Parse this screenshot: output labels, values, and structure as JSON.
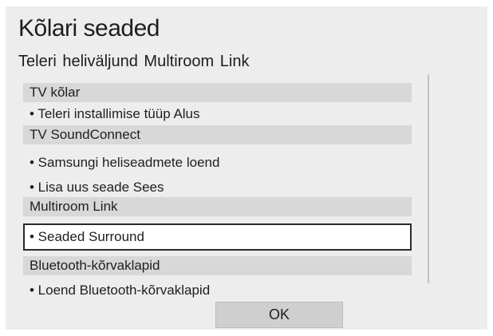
{
  "dialog": {
    "title": "Kõlari seaded",
    "subtitle": "Teleri heliväljund  Multiroom Link"
  },
  "list": {
    "tv_speaker_header": "TV kõlar",
    "tv_install_type": "• Teleri installimise tüüp Alus",
    "soundconnect_header": "TV SoundConnect",
    "samsung_device_list": "• Samsungi heliseadmete loend",
    "add_new_device": "• Lisa uus seade Sees",
    "multiroom_header": "Multiroom Link",
    "surround_settings": "• Seaded Surround",
    "bluetooth_header": "Bluetooth-kõrvaklapid",
    "bluetooth_list": "• Loend Bluetooth-kõrvaklapid"
  },
  "footer": {
    "ok_label": "OK"
  }
}
